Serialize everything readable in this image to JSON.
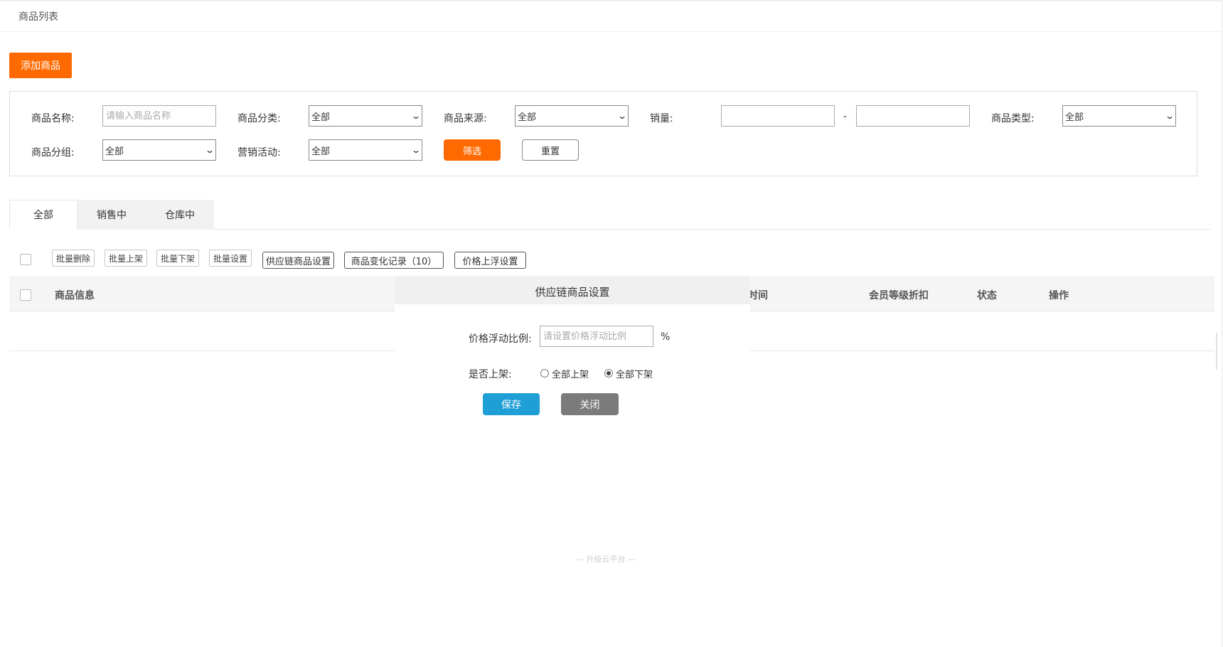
{
  "page": {
    "title": "商品列表"
  },
  "toolbar": {
    "add_label": "添加商品"
  },
  "filters": {
    "name_label": "商品名称:",
    "name_placeholder": "请输入商品名称",
    "category_label": "商品分类:",
    "category_value": "全部",
    "source_label": "商品来源:",
    "source_value": "全部",
    "sales_label": "销量:",
    "sales_separator": "-",
    "type_label": "商品类型:",
    "type_value": "全部",
    "group_label": "商品分组:",
    "group_value": "全部",
    "promo_label": "营销活动:",
    "promo_value": "全部",
    "filter_label": "筛选",
    "reset_label": "重置"
  },
  "tabs": [
    {
      "label": "全部",
      "active": true
    },
    {
      "label": "销售中",
      "active": false
    },
    {
      "label": "仓库中",
      "active": false
    }
  ],
  "batch": {
    "delete": "批量删除",
    "on_shelf": "批量上架",
    "off_shelf": "批量下架",
    "settings": "批量设置",
    "supply_chain": "供应链商品设置",
    "change_log": "商品变化记录（10）",
    "price_float": "价格上浮设置"
  },
  "table": {
    "headers": [
      "商品信息",
      "时间",
      "会员等级折扣",
      "状态",
      "操作"
    ]
  },
  "modal": {
    "title": "供应链商品设置",
    "ratio_label": "价格浮动比例:",
    "ratio_placeholder": "请设置价格浮动比例",
    "percent": "%",
    "shelf_label": "是否上架:",
    "options": [
      {
        "label": "全部上架",
        "checked": false
      },
      {
        "label": "全部下架",
        "checked": true
      }
    ],
    "save_label": "保存",
    "close_label": "关闭"
  },
  "footer": {
    "text": "— 升级云平台 —"
  },
  "colors": {
    "accent": "#ff6a00",
    "primary": "#1e9fd6",
    "secondary": "#7b7b7b"
  }
}
